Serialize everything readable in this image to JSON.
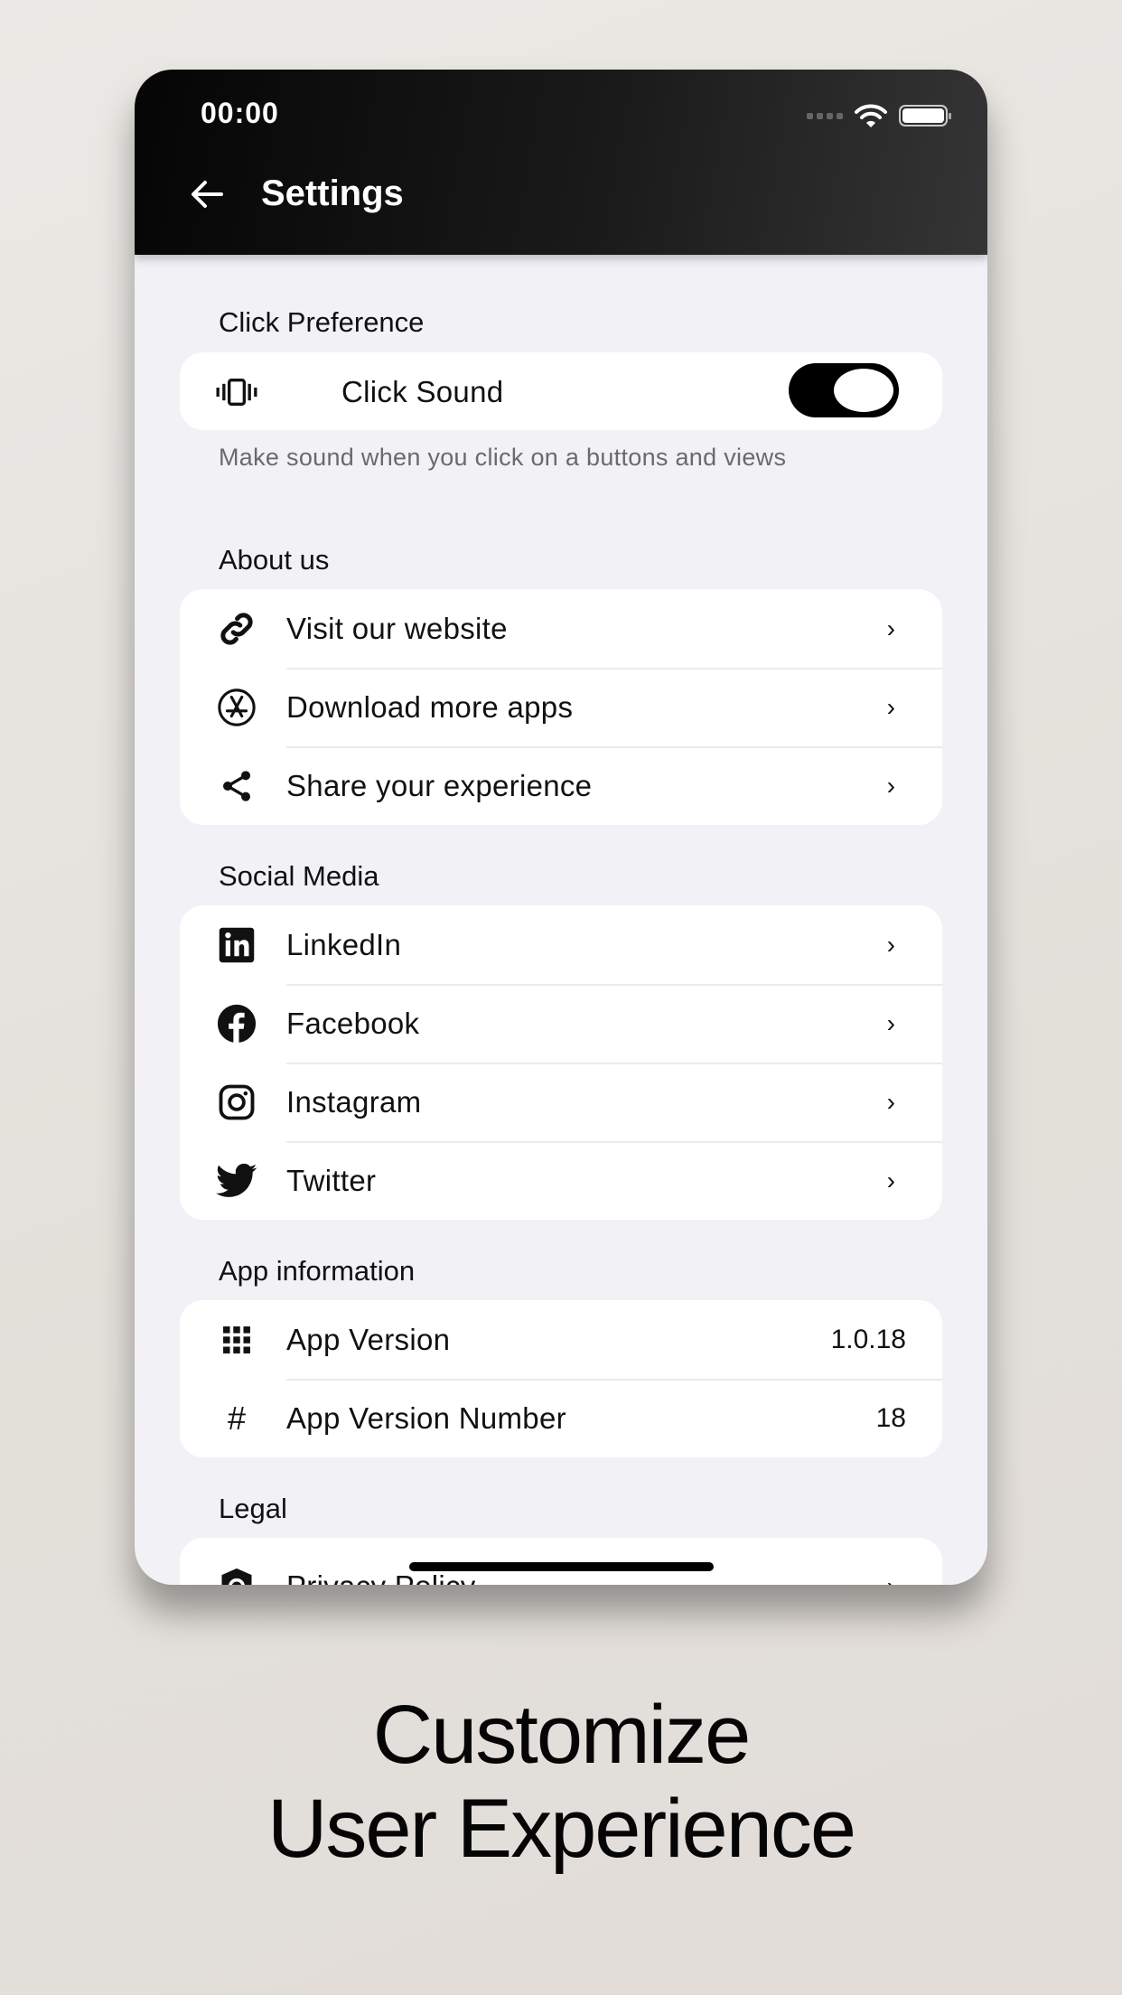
{
  "status_bar": {
    "time": "00:00"
  },
  "header": {
    "title": "Settings"
  },
  "sections": {
    "click": {
      "title": "Click Preference",
      "item": {
        "label": "Click Sound",
        "toggle_on": true
      },
      "description": "Make sound when you click on a buttons and views"
    },
    "about": {
      "title": "About us",
      "items": [
        {
          "label": "Visit our website",
          "icon": "link-icon"
        },
        {
          "label": "Download more apps",
          "icon": "app-store-icon"
        },
        {
          "label": "Share your experience",
          "icon": "share-icon"
        }
      ]
    },
    "social": {
      "title": "Social Media",
      "items": [
        {
          "label": "LinkedIn",
          "icon": "linkedin-icon"
        },
        {
          "label": "Facebook",
          "icon": "facebook-icon"
        },
        {
          "label": "Instagram",
          "icon": "instagram-icon"
        },
        {
          "label": "Twitter",
          "icon": "twitter-icon"
        }
      ]
    },
    "info": {
      "title": "App information",
      "items": [
        {
          "label": "App Version",
          "value": "1.0.18",
          "icon": "grid-icon"
        },
        {
          "label": "App Version Number",
          "value": "18",
          "icon": "hash-icon"
        }
      ]
    },
    "legal": {
      "title": "Legal",
      "items": [
        {
          "label": "Privacy Policy",
          "icon": "privacy-shield-icon"
        }
      ]
    }
  },
  "caption": {
    "line1": "Customize",
    "line2": "User Experience"
  }
}
